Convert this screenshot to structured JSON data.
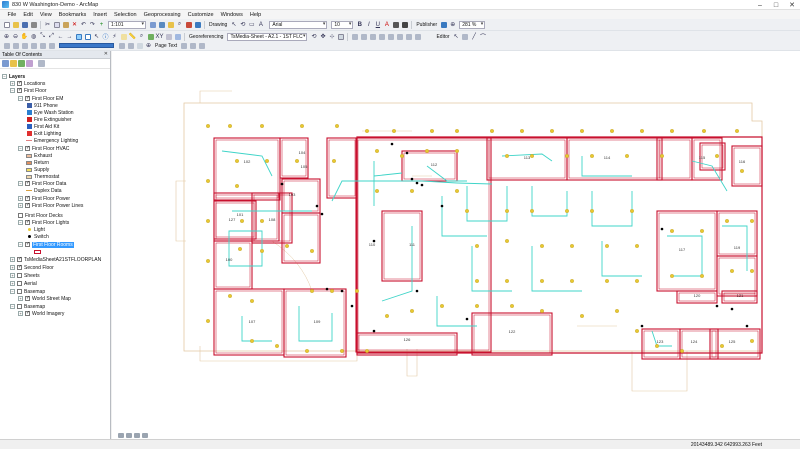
{
  "window": {
    "title": "830 W Washington-Demo - ArcMap"
  },
  "menu": [
    "File",
    "Edit",
    "View",
    "Bookmarks",
    "Insert",
    "Selection",
    "Geoprocessing",
    "Customize",
    "Windows",
    "Help"
  ],
  "toolbar": {
    "scale": "1:101",
    "drawing_label": "Drawing",
    "font_name": "Arial",
    "font_size": "10",
    "publisher_label": "Publisher",
    "zoom_percent": "281 %",
    "georeferencing_label": "Georeferencing",
    "georef_layer": "TsMedia-Sheet - A2.1 - 1ST FLC",
    "editor_label": "Editor",
    "page_text_label": "Page Text"
  },
  "toc": {
    "title": "Table Of Contents",
    "rows": [
      {
        "label": "Layers",
        "bold": true
      },
      {
        "label": "Locations"
      },
      {
        "label": "First Floor"
      },
      {
        "label": "First Floor EM"
      },
      {
        "label": "911 Phone"
      },
      {
        "label": "Eye Wash Station"
      },
      {
        "label": "Fire Extinguisher"
      },
      {
        "label": "First Aid Kit"
      },
      {
        "label": "Exit Lighting"
      },
      {
        "label": "Emergency Lighting"
      },
      {
        "label": "First Floor HVAC"
      },
      {
        "label": "Exhaust"
      },
      {
        "label": "Return"
      },
      {
        "label": "Supply"
      },
      {
        "label": "Thermostat"
      },
      {
        "label": "First Floor Data"
      },
      {
        "label": "Duplex Data"
      },
      {
        "label": "First Floor Power"
      },
      {
        "label": "First Floor Power Lines"
      },
      {
        "label": "First Floor Decks"
      },
      {
        "label": "First Floor Lights"
      },
      {
        "label": "Light"
      },
      {
        "label": "Switch"
      },
      {
        "label": "First Floor Rooms"
      },
      {
        "label": "TsMediaSheetA21STFLOORPLAN"
      },
      {
        "label": "Second Floor"
      },
      {
        "label": "Sheets"
      },
      {
        "label": "Aerial"
      },
      {
        "label": "Basemap"
      },
      {
        "label": "World Street Map"
      },
      {
        "label": "Basemap"
      },
      {
        "label": "World Imagery"
      }
    ]
  },
  "map": {
    "room_labels": [
      "104",
      "105",
      "102",
      "103",
      "101",
      "100",
      "108",
      "107",
      "109",
      "110",
      "111",
      "112",
      "113",
      "114",
      "115",
      "116",
      "117",
      "119",
      "120",
      "121",
      "122",
      "123",
      "124",
      "125",
      "126",
      "127"
    ]
  },
  "status": {
    "coordinates": "20143489.342  642993.263 Feet"
  },
  "colors": {
    "room_outline": "#c8102e",
    "power_line": "#3fd4c8",
    "light_fixture": "#e8c830",
    "floor_plan": "#e3c9a4"
  }
}
